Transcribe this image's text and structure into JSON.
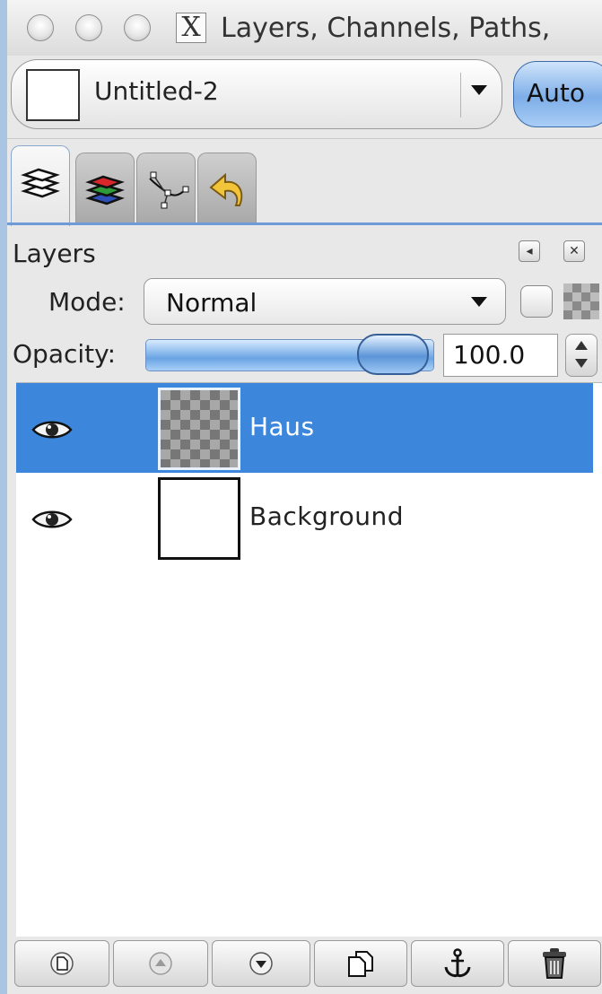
{
  "window": {
    "title": "Layers, Channels, Paths,",
    "x11_label": "X"
  },
  "image_selector": {
    "name": "Untitled-2",
    "auto_label": "Auto"
  },
  "tabs": [
    {
      "name": "Layers",
      "icon": "layers-icon"
    },
    {
      "name": "Channels",
      "icon": "channels-icon"
    },
    {
      "name": "Paths",
      "icon": "paths-icon"
    },
    {
      "name": "Undo History",
      "icon": "undo-history-icon"
    }
  ],
  "layers_panel": {
    "title": "Layers",
    "mode_label": "Mode:",
    "mode_value": "Normal",
    "opacity_label": "Opacity:",
    "opacity_value": "100.0",
    "opacity_fraction": 1.0
  },
  "layers": [
    {
      "name": "Haus",
      "visible": true,
      "selected": true,
      "thumbnail": "transparent"
    },
    {
      "name": "Background",
      "visible": true,
      "selected": false,
      "thumbnail": "white"
    }
  ],
  "bottom_toolbar": [
    {
      "name": "new-layer",
      "icon": "new-layer-icon"
    },
    {
      "name": "raise-layer",
      "icon": "raise-icon"
    },
    {
      "name": "lower-layer",
      "icon": "lower-icon"
    },
    {
      "name": "duplicate-layer",
      "icon": "duplicate-icon"
    },
    {
      "name": "anchor-layer",
      "icon": "anchor-icon"
    },
    {
      "name": "delete-layer",
      "icon": "trash-icon"
    }
  ],
  "colors": {
    "selection": "#3c87dc",
    "accent_blue": "#6f9ad6",
    "desktop": "#aac4e4"
  }
}
